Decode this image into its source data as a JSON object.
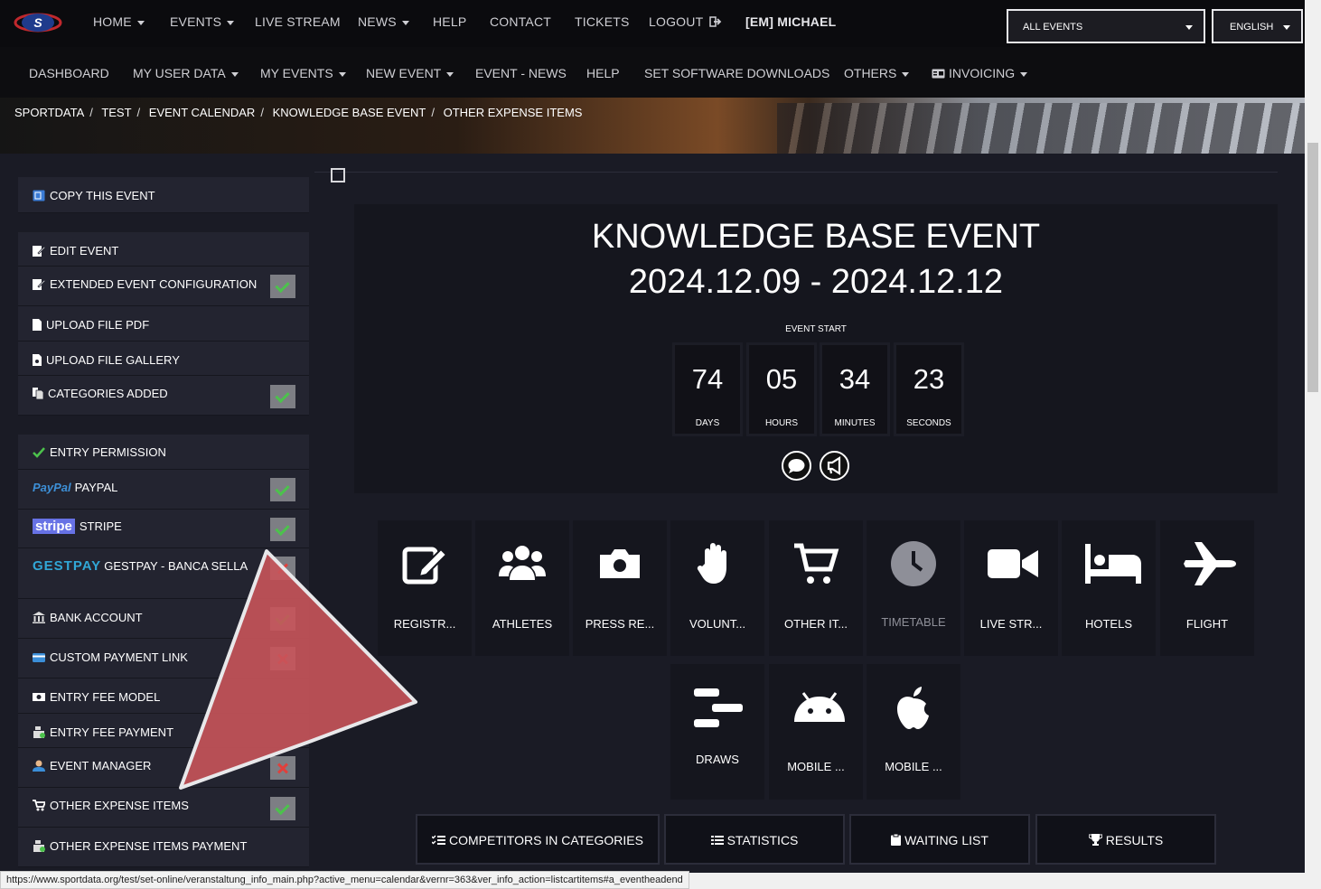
{
  "topnav": {
    "home": "HOME",
    "events": "EVENTS",
    "live_stream": "LIVE STREAM",
    "news": "NEWS",
    "help": "HELP",
    "contact": "CONTACT",
    "tickets": "TICKETS",
    "logout": "LOGOUT",
    "user": "[EM] MICHAEL",
    "all_events": "ALL EVENTS",
    "language": "ENGLISH"
  },
  "subnav": {
    "dashboard": "DASHBOARD",
    "my_user_data": "MY USER DATA",
    "my_events": "MY EVENTS",
    "new_event": "NEW EVENT",
    "event_news": "EVENT - NEWS",
    "help": "HELP",
    "set_software_downloads": "SET SOFTWARE DOWNLOADS",
    "others": "OTHERS",
    "invoicing": "INVOICING"
  },
  "breadcrumb": [
    "SPORTDATA",
    "TEST",
    "EVENT CALENDAR",
    "KNOWLEDGE BASE EVENT",
    "OTHER EXPENSE ITEMS"
  ],
  "sidebar": {
    "copy_event": "COPY THIS EVENT",
    "edit_event": "EDIT EVENT",
    "extended_config": "EXTENDED EVENT CONFIGURATION",
    "upload_pdf": "UPLOAD FILE PDF",
    "upload_gallery": "UPLOAD FILE GALLERY",
    "categories_added": "CATEGORIES ADDED",
    "entry_permission": "ENTRY PERMISSION",
    "paypal_logo": "PayPal",
    "paypal": "PAYPAL",
    "stripe_logo": "stripe",
    "stripe": "STRIPE",
    "gestpay_logo": "GESTPAY",
    "gestpay": "GESTPAY - BANCA SELLA",
    "bank_account": "BANK ACCOUNT",
    "custom_payment_link": "CUSTOM PAYMENT LINK",
    "entry_fee_model": "ENTRY FEE MODEL",
    "entry_fee_payment": "ENTRY FEE PAYMENT",
    "event_manager": "EVENT MANAGER",
    "other_expense_items": "OTHER EXPENSE ITEMS",
    "other_expense_items_payment": "OTHER EXPENSE ITEMS PAYMENT"
  },
  "event": {
    "title": "KNOWLEDGE BASE EVENT",
    "dates": "2024.12.09 - 2024.12.12",
    "start_label": "EVENT START",
    "countdown": {
      "days": "74",
      "days_label": "DAYS",
      "hours": "05",
      "hours_label": "HOURS",
      "minutes": "34",
      "minutes_label": "MINUTES",
      "seconds": "23",
      "seconds_label": "SECONDS"
    }
  },
  "tiles": {
    "registration": "REGISTR...",
    "athletes": "ATHLETES",
    "press": "PRESS RE...",
    "volunteers": "VOLUNT...",
    "other_items": "OTHER IT...",
    "timetable": "TIMETABLE",
    "live_stream": "LIVE STR...",
    "hotels": "HOTELS",
    "flight": "FLIGHT",
    "draws": "DRAWS",
    "mobile_android": "MOBILE ...",
    "mobile_ios": "MOBILE ..."
  },
  "buttons": {
    "competitors": "COMPETITORS IN CATEGORIES",
    "statistics": "STATISTICS",
    "waiting_list": "WAITING LIST",
    "results": "RESULTS"
  },
  "status_url": "https://www.sportdata.org/test/set-online/veranstaltung_info_main.php?active_menu=calendar&vernr=363&ver_info_action=listcartitems#a_eventheadend"
}
